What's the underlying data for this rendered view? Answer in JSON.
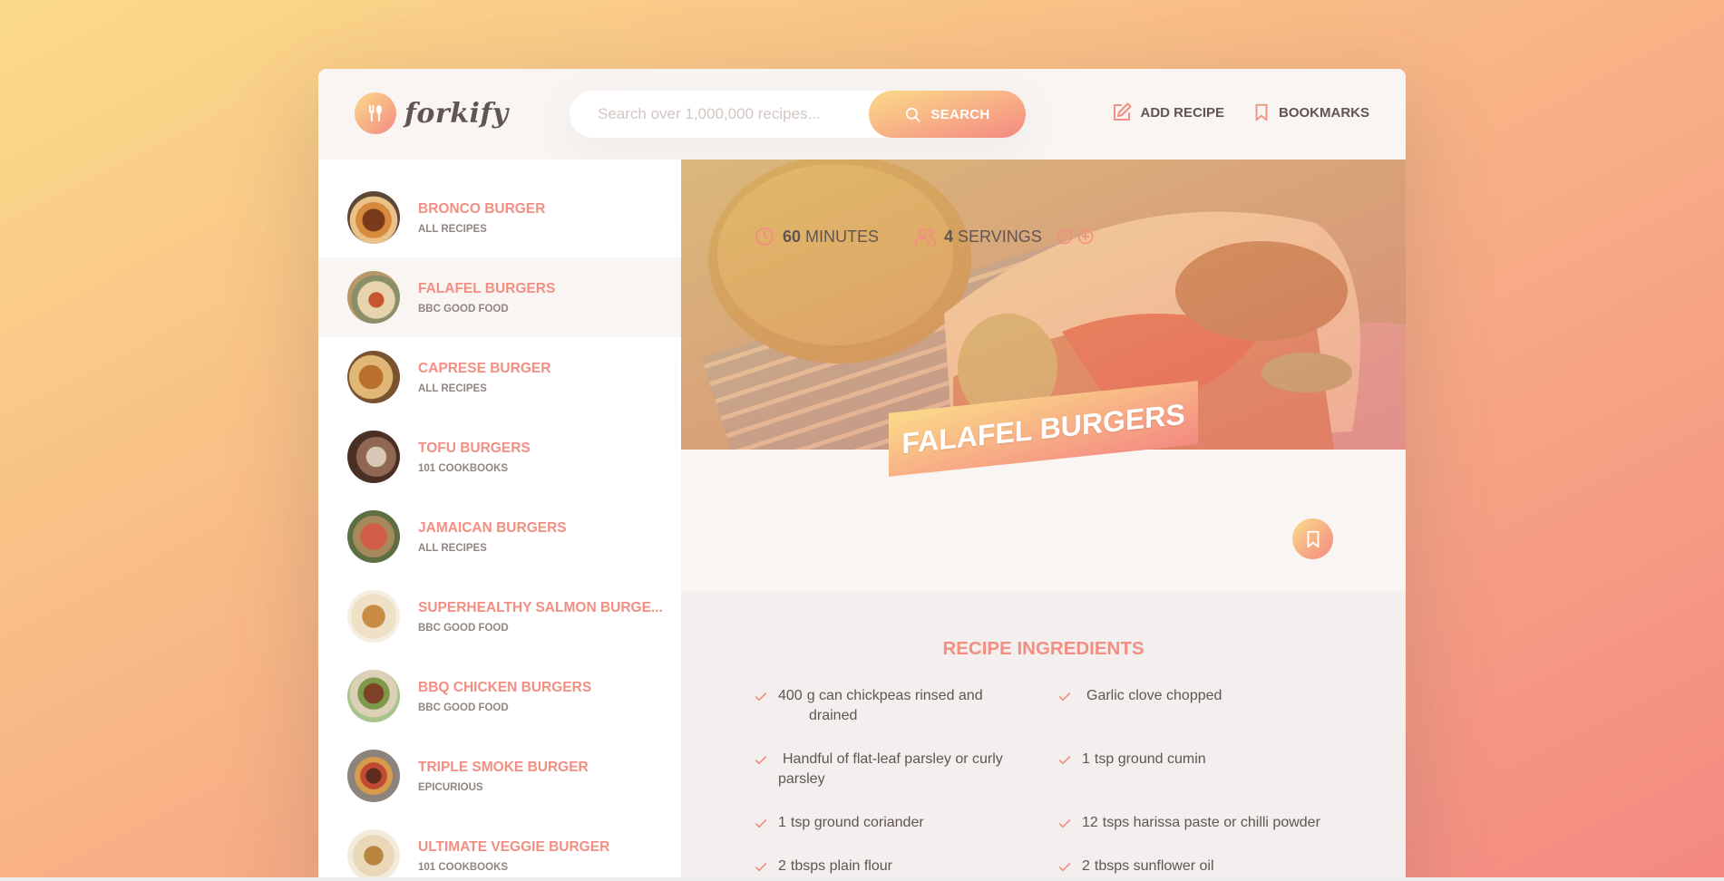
{
  "logo": {
    "text": "forkify"
  },
  "search": {
    "placeholder": "Search over 1,000,000 recipes...",
    "button_label": "SEARCH"
  },
  "nav": {
    "add_recipe": "ADD RECIPE",
    "bookmarks": "BOOKMARKS"
  },
  "results": [
    {
      "title": "BRONCO BURGER",
      "publisher": "ALL RECIPES"
    },
    {
      "title": "FALAFEL BURGERS",
      "publisher": "BBC GOOD FOOD"
    },
    {
      "title": "CAPRESE BURGER",
      "publisher": "ALL RECIPES"
    },
    {
      "title": "TOFU BURGERS",
      "publisher": "101 COOKBOOKS"
    },
    {
      "title": "JAMAICAN BURGERS",
      "publisher": "ALL RECIPES"
    },
    {
      "title": "SUPERHEALTHY SALMON BURGE...",
      "publisher": "BBC GOOD FOOD"
    },
    {
      "title": "BBQ CHICKEN BURGERS",
      "publisher": "BBC GOOD FOOD"
    },
    {
      "title": "TRIPLE SMOKE BURGER",
      "publisher": "EPICURIOUS"
    },
    {
      "title": "ULTIMATE VEGGIE BURGER",
      "publisher": "101 COOKBOOKS"
    }
  ],
  "recipe": {
    "title": "FALAFEL BURGERS",
    "minutes_value": "60",
    "minutes_label": "MINUTES",
    "servings_value": "4",
    "servings_label": "SERVINGS"
  },
  "ingredients": {
    "heading": "RECIPE INGREDIENTS",
    "items": [
      {
        "quantity": "400",
        "text": "g can chickpeas rinsed and",
        "text2": "drained"
      },
      {
        "quantity": "",
        "text": "Garlic clove chopped"
      },
      {
        "quantity": "",
        "text": "Handful of flat-leaf parsley or curly",
        "text2": "parsley"
      },
      {
        "quantity": "1",
        "text": "tsp ground cumin"
      },
      {
        "quantity": "1",
        "text": "tsp ground coriander"
      },
      {
        "quantity": "12",
        "text": "tsps harissa paste or chilli powder"
      },
      {
        "quantity": "2",
        "text": "tbsps plain flour"
      },
      {
        "quantity": "2",
        "text": "tbsps sunflower oil"
      }
    ]
  },
  "colors": {
    "accent": "#f38e82",
    "gradient_start": "#fbdb89",
    "gradient_end": "#f48982",
    "text": "#615551"
  }
}
